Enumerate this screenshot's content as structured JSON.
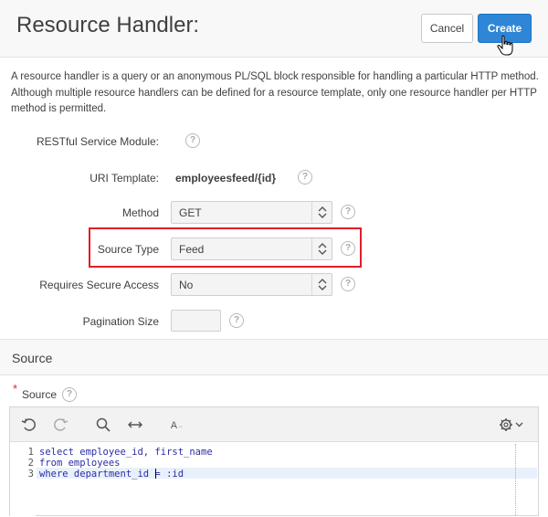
{
  "header": {
    "title": "Resource Handler:",
    "cancel_label": "Cancel",
    "create_label": "Create"
  },
  "description": "A resource handler is a query or an anonymous PL/SQL block responsible for handling a particular HTTP method. Although multiple resource handlers can be defined for a resource template, only one resource handler per HTTP method is permitted.",
  "form": {
    "module_label": "RESTful Service Module:",
    "uri_label": "URI Template:",
    "uri_value": "employeesfeed/{id}",
    "method_label": "Method",
    "method_value": "GET",
    "source_type_label": "Source Type",
    "source_type_value": "Feed",
    "secure_label": "Requires Secure Access",
    "secure_value": "No",
    "pagination_label": "Pagination Size",
    "pagination_value": ""
  },
  "source_section": {
    "title": "Source",
    "required_mark": "*",
    "label": "Source"
  },
  "editor": {
    "line_numbers": [
      "1",
      "2",
      "3"
    ],
    "lines": [
      "select employee_id, first_name",
      "from employees",
      "where department_id = :id"
    ]
  },
  "icons": {
    "help": "?",
    "undo": "undo-icon",
    "redo": "redo-icon",
    "search": "search-icon",
    "expand": "expand-width-icon",
    "font": "font-size-icon",
    "settings": "gear-icon"
  },
  "colors": {
    "primary": "#2f86d7",
    "highlight": "#e01e2b",
    "required": "#d7282f"
  }
}
